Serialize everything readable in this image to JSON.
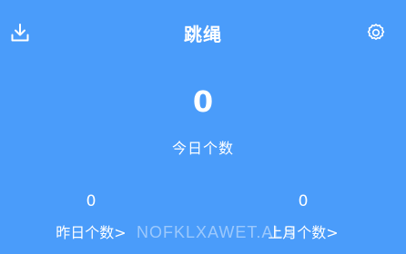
{
  "header": {
    "title": "跳绳",
    "left_icon": "download-icon",
    "right_icon": "gear-icon"
  },
  "today": {
    "value": "0",
    "label": "今日个数"
  },
  "stats": [
    {
      "value": "0",
      "label": "昨日个数>"
    },
    {
      "value": "0",
      "label": "上月个数>"
    }
  ],
  "watermark": "NOFKLXAWET.ALS",
  "colors": {
    "background": "#4a9cfa",
    "text": "#ffffff"
  }
}
